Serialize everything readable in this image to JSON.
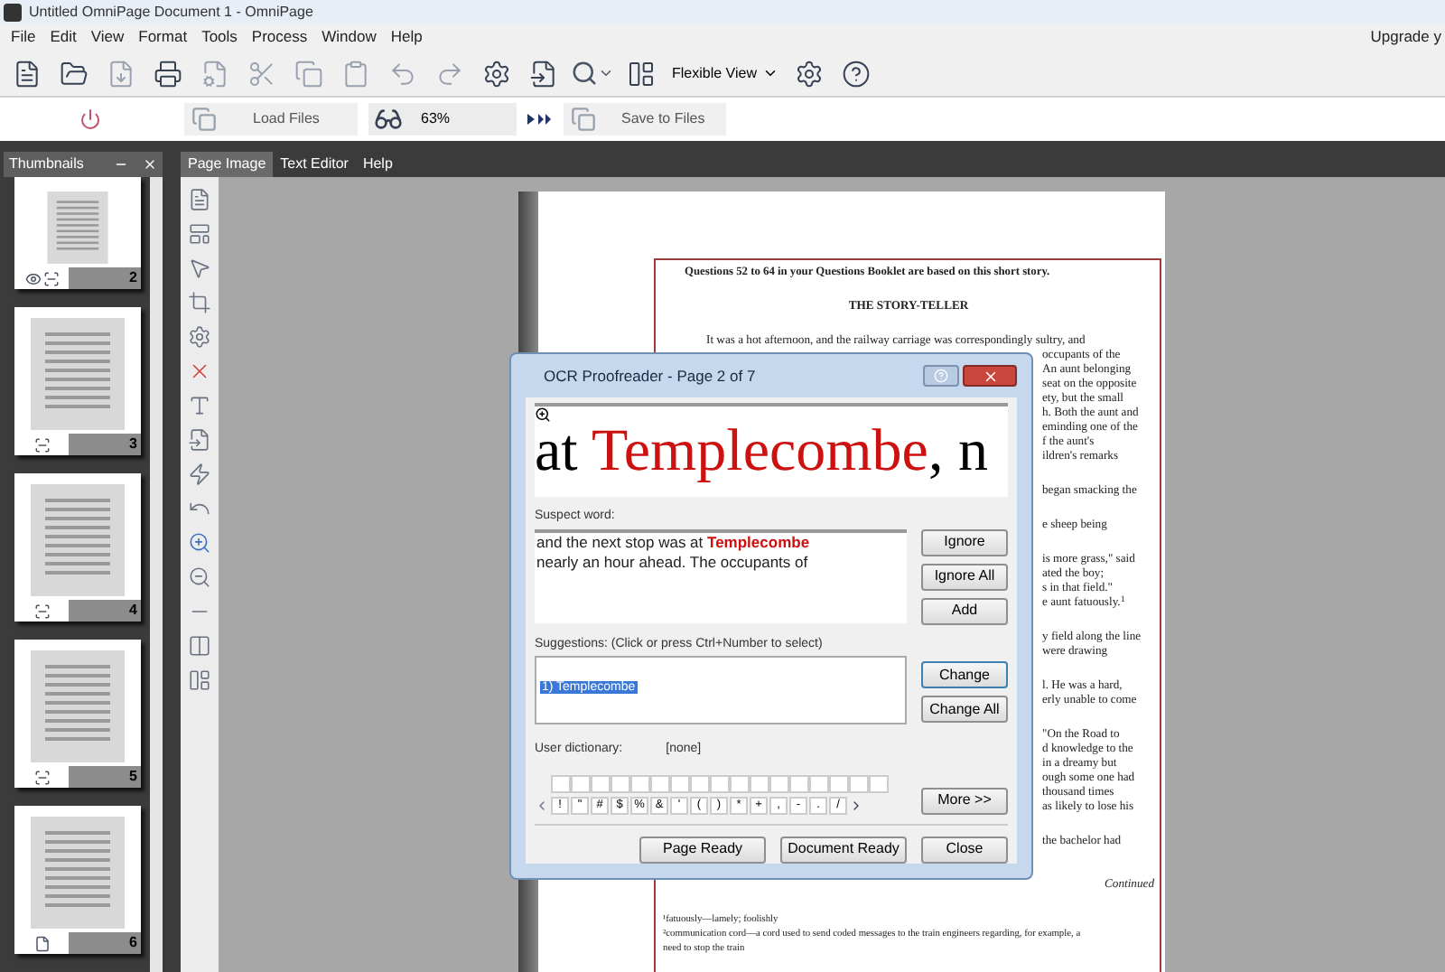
{
  "window": {
    "title": "Untitled OmniPage Document 1 - OmniPage"
  },
  "menu": [
    "File",
    "Edit",
    "View",
    "Format",
    "Tools",
    "Process",
    "Window",
    "Help"
  ],
  "upgrade_link": "Upgrade y",
  "toolbar": {
    "view_mode": "Flexible View"
  },
  "workflow_bar": {
    "load_label": "Load Files",
    "zoom": "63%",
    "save_label": "Save to Files"
  },
  "thumbnails_panel": {
    "title": "Thumbnails",
    "items": [
      {
        "number": "2",
        "current": true,
        "recognized": true
      },
      {
        "number": "3",
        "current": false,
        "recognized": true
      },
      {
        "number": "4",
        "current": false,
        "recognized": true
      },
      {
        "number": "5",
        "current": false,
        "recognized": true
      },
      {
        "number": "6",
        "current": false,
        "recognized": false
      }
    ]
  },
  "tabs": [
    {
      "label": "Page Image",
      "selected": true
    },
    {
      "label": "Text Editor",
      "selected": false
    },
    {
      "label": "Help",
      "selected": false
    }
  ],
  "document": {
    "paragraphs": [
      {
        "kind": "heading",
        "lines": [
          "Questions 52 to 64 in your Questions Booklet are based on this short story."
        ]
      },
      {
        "kind": "title",
        "lines": [
          "THE STORY-TELLER"
        ]
      },
      {
        "kind": "body",
        "lines": [
          "It was a hot afternoon, and the railway carriage was correspondingly sultry, and"
        ]
      },
      {
        "kind": "fragment",
        "lines": [
          "occupants of the",
          "An aunt belonging",
          "seat on the opposite",
          "ety, but the small",
          "h.  Both the aunt and",
          "eminding one of the",
          "f the aunt's",
          "ildren's remarks"
        ]
      },
      {
        "kind": "fragment",
        "lines": [
          "began smacking the"
        ]
      },
      {
        "kind": "fragment",
        "lines": [
          "e sheep being"
        ]
      },
      {
        "kind": "fragment",
        "lines": [
          "is more grass,\" said",
          "ated the boy;",
          "s in that field.\"",
          "e aunt fatuously.$^{1}$"
        ]
      },
      {
        "kind": "fragment",
        "lines": [
          "y field along the line",
          "were drawing"
        ]
      },
      {
        "kind": "fragment",
        "lines": [
          "l.  He was a hard,",
          "erly unable to come"
        ]
      },
      {
        "kind": "fragment",
        "lines": [
          "\"On the Road to",
          "d knowledge to the",
          "in a dreamy but",
          "ough some one had",
          "thousand times",
          "as likely to lose his"
        ]
      },
      {
        "kind": "fragment",
        "lines": [
          "the bachelor had"
        ]
      },
      {
        "kind": "continued",
        "lines": [
          "Continued"
        ]
      },
      {
        "kind": "footnote",
        "lines": [
          "¹fatuously—lamely; foolishly",
          "²communication cord—a cord used to send coded messages to the train engineers regarding, for example, a",
          "need to stop the train"
        ]
      }
    ]
  },
  "proofreader": {
    "title": "OCR Proofreader - Page 2 of 7",
    "image_text": {
      "before": "at ",
      "word": "Templecombe",
      "after": ", n"
    },
    "suspect_label": "Suspect word:",
    "suspect_text": {
      "before": "and the next stop was at ",
      "word": "Templecombe",
      "after": "nearly an hour ahead. The occupants of"
    },
    "suggestions_label": "Suggestions: (Click or press Ctrl+Number to select)",
    "suggestions": [
      {
        "text": "1) Templecombe",
        "selected": true
      }
    ],
    "dictionary_label": "User dictionary:",
    "dictionary_value": "[none]",
    "characters": [
      "!",
      "\"",
      "#",
      "$",
      "%",
      "&",
      "'",
      "(",
      ")",
      "*",
      "+",
      ",",
      "-",
      ".",
      "/"
    ],
    "side_buttons": [
      {
        "label": "Ignore",
        "default": false
      },
      {
        "label": "Ignore All",
        "default": false
      },
      {
        "label": "Add",
        "default": false
      },
      {
        "label": "Change",
        "default": true
      },
      {
        "label": "Change All",
        "default": false
      },
      {
        "label": "More >>",
        "default": false
      }
    ],
    "bottom_buttons": [
      "Page Ready",
      "Document Ready",
      "Close"
    ]
  }
}
